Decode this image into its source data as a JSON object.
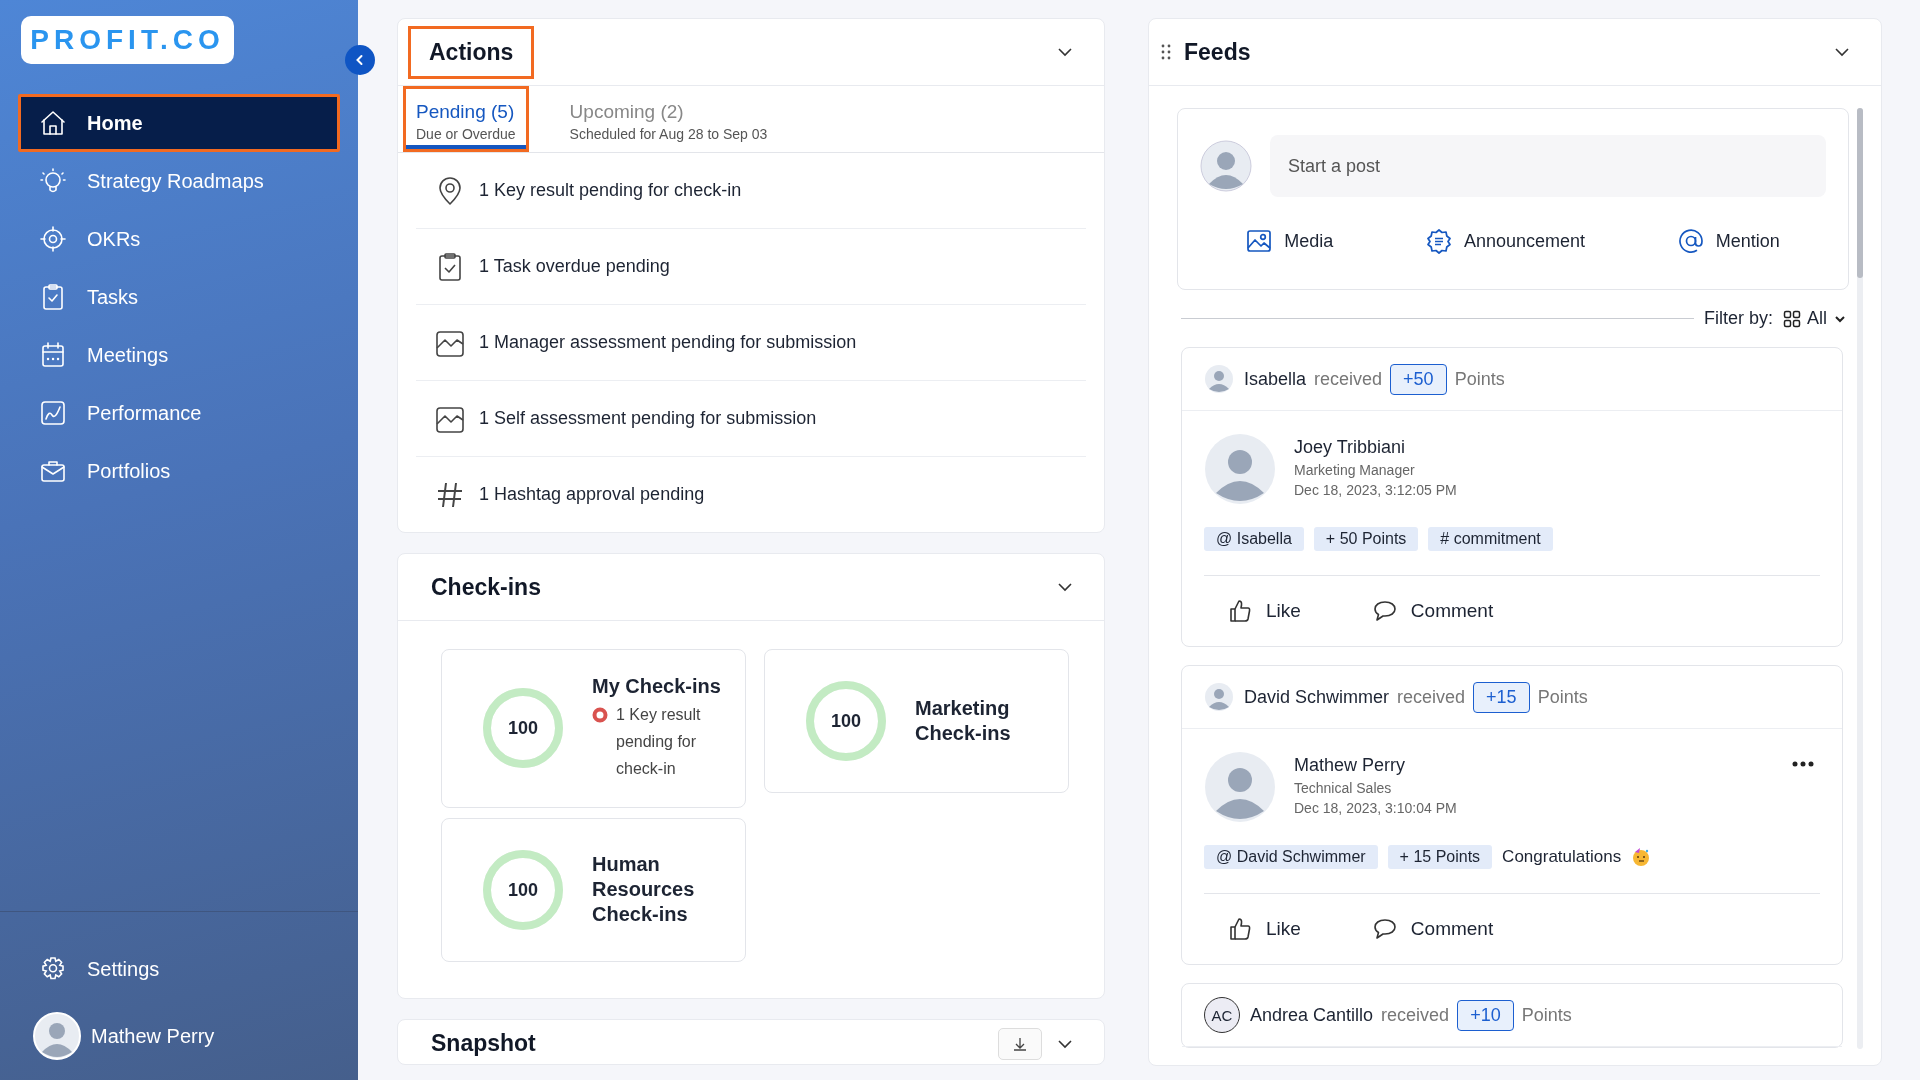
{
  "sidebar": {
    "logo": "PROFIT.CO",
    "items": [
      {
        "label": "Home",
        "kind": "home",
        "selected": true
      },
      {
        "label": "Strategy Roadmaps",
        "kind": "bulb",
        "selected": false
      },
      {
        "label": "OKRs",
        "kind": "target",
        "selected": false
      },
      {
        "label": "Tasks",
        "kind": "clipboard",
        "selected": false
      },
      {
        "label": "Meetings",
        "kind": "calendar",
        "selected": false
      },
      {
        "label": "Performance",
        "kind": "chart",
        "selected": false
      },
      {
        "label": "Portfolios",
        "kind": "briefcase",
        "selected": false
      }
    ],
    "settings": {
      "label": "Settings"
    },
    "user": {
      "name": "Mathew Perry"
    }
  },
  "actions": {
    "title": "Actions",
    "highlighted": true,
    "tabs": [
      {
        "label": "Pending (5)",
        "sublabel": "Due or Overdue",
        "selected": true
      },
      {
        "label": "Upcoming (2)",
        "sublabel": "Scheduled for Aug 28 to Sep 03",
        "selected": false
      }
    ],
    "items": [
      {
        "kind": "pin",
        "text": "1 Key result pending for check-in"
      },
      {
        "kind": "task",
        "text": "1 Task overdue pending"
      },
      {
        "kind": "assessment",
        "text": "1 Manager assessment pending for submission"
      },
      {
        "kind": "assessment",
        "text": "1 Self assessment pending for submission"
      },
      {
        "kind": "hashtag",
        "text": "1 Hashtag approval pending"
      }
    ]
  },
  "checkins": {
    "title": "Check-ins",
    "cards": [
      {
        "title": "My Check-ins",
        "value": "100",
        "level": 1,
        "note": "1 Key result pending for check-in"
      },
      {
        "title": "Marketing Check-ins",
        "value": "100",
        "level": 1
      },
      {
        "title": "Human Resources Check-ins",
        "value": "100",
        "level": 1
      }
    ]
  },
  "snapshot": {
    "title": "Snapshot"
  },
  "feeds": {
    "title": "Feeds",
    "composer": {
      "placeholder": "Start a post",
      "actions": [
        {
          "kind": "media",
          "label": "Media"
        },
        {
          "kind": "announcement",
          "label": "Announcement"
        },
        {
          "kind": "mention",
          "label": "Mention"
        }
      ]
    },
    "filter": {
      "label": "Filter by:",
      "value": "All"
    },
    "posts": [
      {
        "recipient": "Isabella",
        "verb": "received",
        "points": "+50",
        "unit": "Points",
        "author": "Joey Tribbiani",
        "role": "Marketing Manager",
        "date": "Dec 18, 2023, 3:12:05 PM",
        "tags": [
          "@ Isabella",
          "+ 50 Points",
          "# commitment"
        ],
        "like": "Like",
        "comment": "Comment"
      },
      {
        "recipient": "David Schwimmer",
        "verb": "received",
        "points": "+15",
        "unit": "Points",
        "author": "Mathew Perry",
        "role": "Technical Sales",
        "date": "Dec 18, 2023, 3:10:04 PM",
        "tags": [
          "@ David Schwimmer",
          "+ 15 Points"
        ],
        "message": "Congratulations",
        "emoji": true,
        "more": true,
        "like": "Like",
        "comment": "Comment"
      },
      {
        "recipient": "Andrea Cantillo",
        "initials": "AC",
        "verb": "received",
        "points": "+10",
        "unit": "Points"
      }
    ]
  }
}
